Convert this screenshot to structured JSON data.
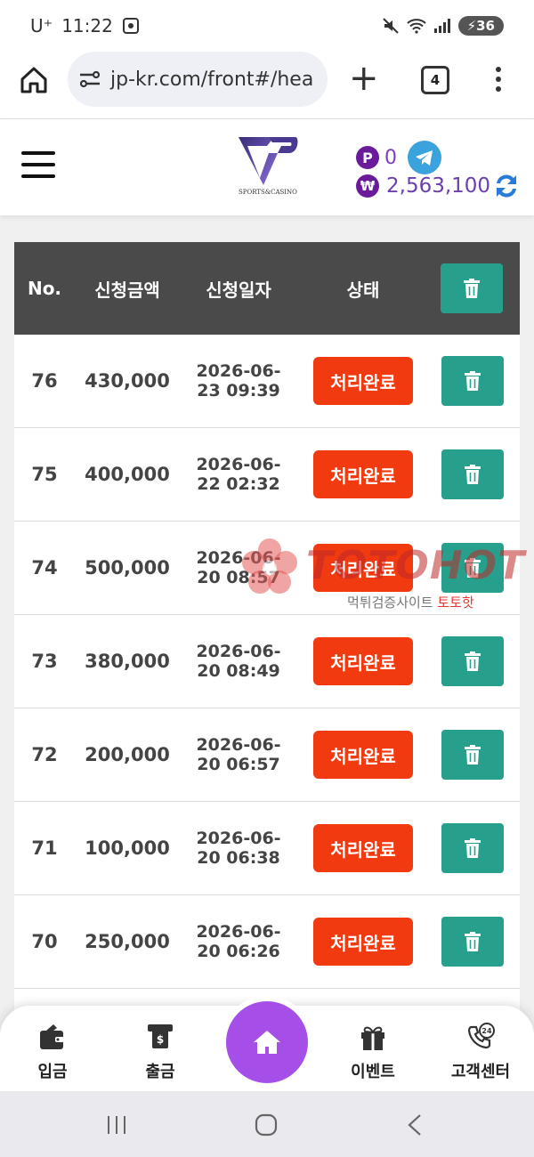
{
  "status_bar": {
    "carrier": "U⁺",
    "time": "11:22",
    "battery": "36"
  },
  "browser": {
    "url": "jp-kr.com/front#/hea",
    "tab_count": "4"
  },
  "header": {
    "logo_caption": "SPORTS&CASINO",
    "points_badge": "P",
    "points": "0",
    "currency_badge": "₩",
    "balance": "2,563,100"
  },
  "table": {
    "columns": {
      "no": "No.",
      "amount": "신청금액",
      "date": "신청일자",
      "status": "상태"
    },
    "rows": [
      {
        "no": "76",
        "amount": "430,000",
        "date1": "2026-06-",
        "date2": "23 09:39",
        "status": "처리완료"
      },
      {
        "no": "75",
        "amount": "400,000",
        "date1": "2026-06-",
        "date2": "22 02:32",
        "status": "처리완료"
      },
      {
        "no": "74",
        "amount": "500,000",
        "date1": "2026-06-",
        "date2": "20 08:57",
        "status": "처리완료"
      },
      {
        "no": "73",
        "amount": "380,000",
        "date1": "2026-06-",
        "date2": "20 08:49",
        "status": "처리완료"
      },
      {
        "no": "72",
        "amount": "200,000",
        "date1": "2026-06-",
        "date2": "20 06:57",
        "status": "처리완료"
      },
      {
        "no": "71",
        "amount": "100,000",
        "date1": "2026-06-",
        "date2": "20 06:38",
        "status": "처리완료"
      },
      {
        "no": "70",
        "amount": "250,000",
        "date1": "2026-06-",
        "date2": "20 06:26",
        "status": "처리완료"
      }
    ]
  },
  "watermark": {
    "brand": "TOTOHOT",
    "sub_gray": "먹튀검증사이트",
    "sub_red": "토토핫"
  },
  "bottom_nav": {
    "deposit": "입금",
    "withdraw": "출금",
    "event": "이벤트",
    "support": "고객센터",
    "support_badge": "24"
  },
  "colors": {
    "status_done": "#f13a10",
    "delete": "#26a08c",
    "header_bg": "#4a4a4a",
    "home_fab": "#a64fe8",
    "brand_purple": "#6a1b9a"
  },
  "icons": [
    "home-icon",
    "site-settings-icon",
    "plus-icon",
    "tabs-icon",
    "kebab-menu-icon",
    "hamburger-icon",
    "telegram-icon",
    "refresh-icon",
    "trash-icon",
    "wallet-icon",
    "atm-icon",
    "gift-icon",
    "phone-24-icon"
  ]
}
